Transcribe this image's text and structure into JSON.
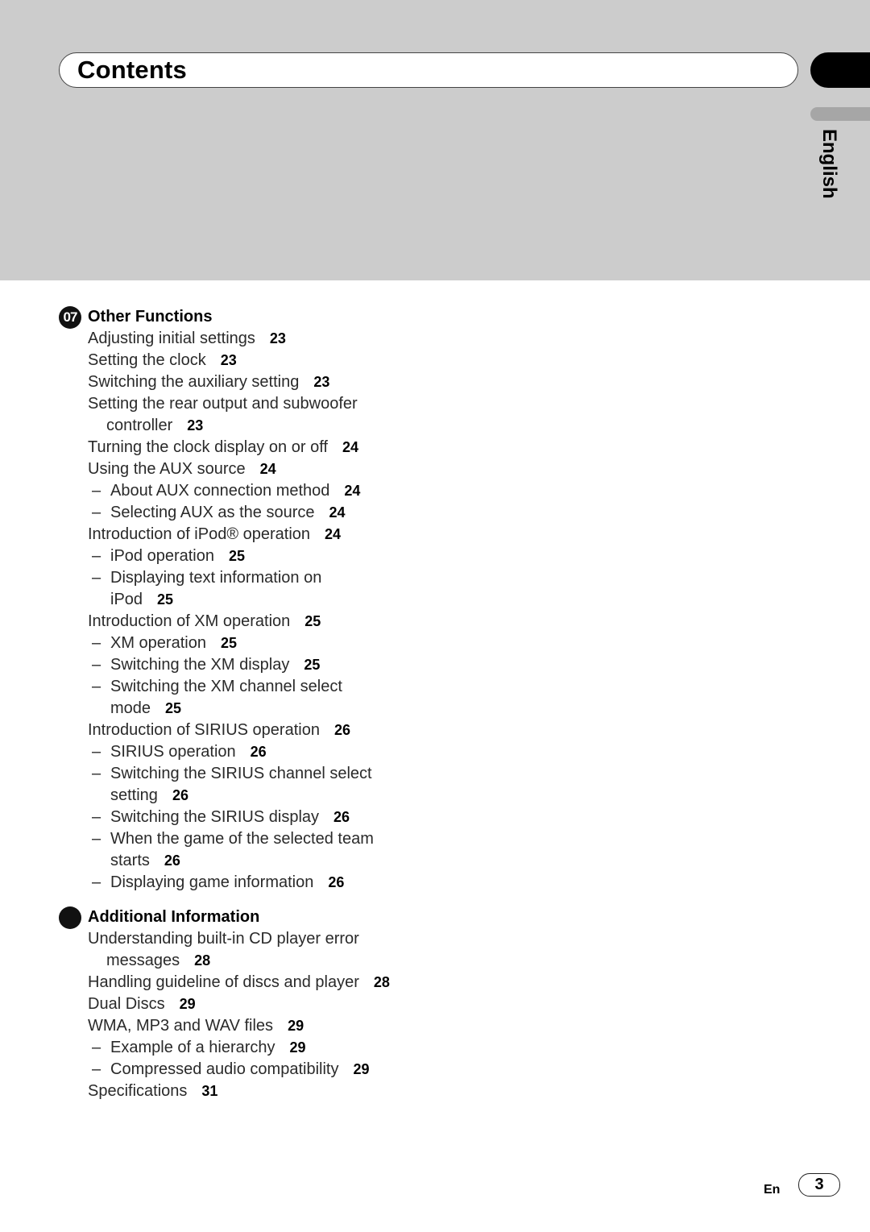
{
  "header": {
    "title": "Contents",
    "language_tab": "English"
  },
  "sections": [
    {
      "badge": "07",
      "title": "Other Functions",
      "entries": [
        {
          "level": 1,
          "text": "Adjusting initial settings",
          "page": "23"
        },
        {
          "level": 1,
          "text": "Setting the clock",
          "page": "23"
        },
        {
          "level": 1,
          "text": "Switching the auxiliary setting",
          "page": "23"
        },
        {
          "level": 1,
          "text": "Setting the rear output and subwoofer",
          "cont": "controller",
          "page": "23"
        },
        {
          "level": 1,
          "text": "Turning the clock display on or off",
          "page": "24"
        },
        {
          "level": 1,
          "text": "Using the AUX source",
          "page": "24"
        },
        {
          "level": 2,
          "text": "About AUX connection method",
          "page": "24"
        },
        {
          "level": 2,
          "text": "Selecting AUX as the source",
          "page": "24"
        },
        {
          "level": 1,
          "text": "Introduction of iPod® operation",
          "page": "24"
        },
        {
          "level": 2,
          "text": "iPod operation",
          "page": "25"
        },
        {
          "level": 2,
          "text": "Displaying text information on",
          "cont": "iPod",
          "page": "25"
        },
        {
          "level": 1,
          "text": "Introduction of XM operation",
          "page": "25"
        },
        {
          "level": 2,
          "text": "XM operation",
          "page": "25"
        },
        {
          "level": 2,
          "text": "Switching the XM display",
          "page": "25"
        },
        {
          "level": 2,
          "text": "Switching the XM channel select",
          "cont": "mode",
          "page": "25"
        },
        {
          "level": 1,
          "text": "Introduction of SIRIUS operation",
          "page": "26"
        },
        {
          "level": 2,
          "text": "SIRIUS operation",
          "page": "26"
        },
        {
          "level": 2,
          "text": "Switching the SIRIUS channel select",
          "cont": "setting",
          "page": "26"
        },
        {
          "level": 2,
          "text": "Switching the SIRIUS display",
          "page": "26"
        },
        {
          "level": 2,
          "text": "When the game of the selected team",
          "cont": "starts",
          "page": "26"
        },
        {
          "level": 2,
          "text": "Displaying game information",
          "page": "26"
        }
      ]
    },
    {
      "badge": "",
      "title": "Additional Information",
      "entries": [
        {
          "level": 1,
          "text": "Understanding built-in CD player error",
          "cont": "messages",
          "page": "28"
        },
        {
          "level": 1,
          "text": "Handling guideline of discs and player",
          "page": "28"
        },
        {
          "level": 1,
          "text": "Dual Discs",
          "page": "29"
        },
        {
          "level": 1,
          "text": "WMA, MP3 and WAV files",
          "page": "29"
        },
        {
          "level": 2,
          "text": "Example of a hierarchy",
          "page": "29"
        },
        {
          "level": 2,
          "text": "Compressed audio compatibility",
          "page": "29"
        },
        {
          "level": 1,
          "text": "Specifications",
          "page": "31"
        }
      ]
    }
  ],
  "footer": {
    "lang_code": "En",
    "page_number": "3"
  },
  "dash": "–"
}
